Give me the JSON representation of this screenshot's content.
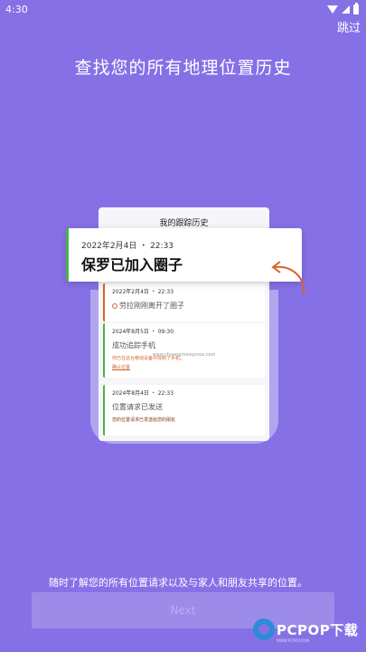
{
  "status_bar": {
    "time": "4:30",
    "icons": [
      "wifi-icon",
      "signal-icon",
      "battery-icon"
    ]
  },
  "skip_label": "跳过",
  "headline": "查找您的所有地理位置历史",
  "illustration": {
    "panel_title": "我的跟踪历史",
    "featured": {
      "date": "2022年2月4日 ・ 22:33",
      "text": "保罗已加入圈子"
    },
    "entries": [
      {
        "date": "2022年2月4日 ・ 22:33",
        "text": "劳拉刚刚离开了圈子"
      },
      {
        "date": "2024年8月5日 ・ 09:30",
        "text": "成功追踪手机",
        "sub": "你已在这台移动设备中找到了手机。",
        "link": "确认位置"
      },
      {
        "date": "2024年8月4日 ・ 22:33",
        "text": "位置请求已发送",
        "sub": "您的位置请求已发送给您的朋友"
      }
    ],
    "watermark": "www.chuangmeixpress.com"
  },
  "description": "随时了解您的所有位置请求以及与家人和朋友共享的位置。",
  "next_label": "Next",
  "brand": {
    "name": "PCPOP下载",
    "tagline": "WWW.PCPOP.COM"
  },
  "colors": {
    "background": "#8670e6",
    "accent_green": "#45b549",
    "accent_orange": "#d4632a"
  }
}
